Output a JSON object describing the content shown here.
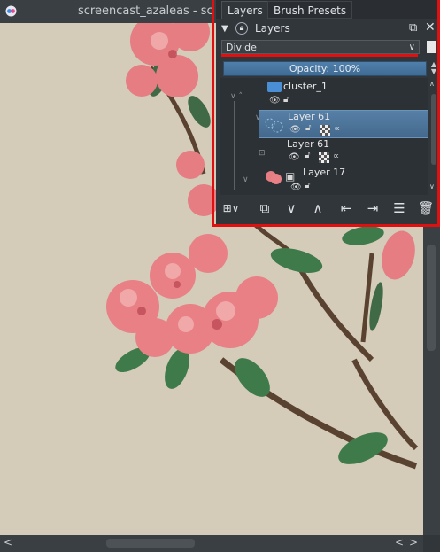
{
  "document": {
    "title": "screencast_azaleas - sc"
  },
  "docker": {
    "tabs": [
      {
        "label": "Layers",
        "active": true
      },
      {
        "label": "Brush Presets",
        "active": false
      }
    ],
    "header_label": "Layers",
    "blend_mode": "Divide",
    "opacity_label": "Opacity:  100%",
    "layers": [
      {
        "name": "cluster_1",
        "type": "group",
        "selected": false
      },
      {
        "name": "Layer 61",
        "type": "paint",
        "selected": true
      },
      {
        "name": "Layer 61",
        "type": "paint",
        "selected": false
      },
      {
        "name": "Layer 17",
        "type": "paint",
        "selected": false
      }
    ]
  },
  "colors": {
    "highlight_frame": "#e01010",
    "selected_row": "#4f7fab",
    "canvas_bg": "#d4cbb9"
  },
  "icons": {
    "visibility": "eye-icon",
    "lock": "lock-icon",
    "alpha": "alpha-lock-icon",
    "inherit": "inherit-alpha-icon"
  }
}
